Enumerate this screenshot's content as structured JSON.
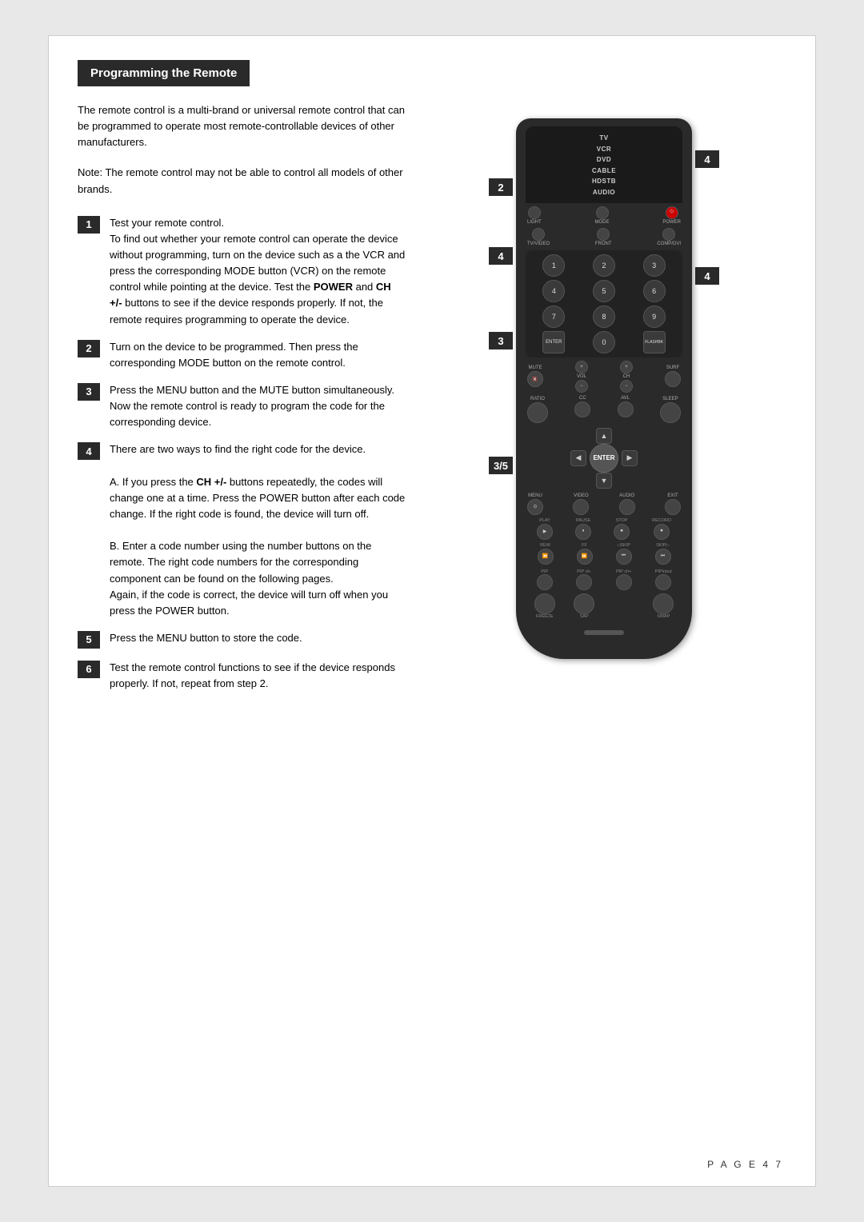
{
  "page": {
    "title": "Programming the Remote",
    "page_number": "P A G E  4 7"
  },
  "intro": {
    "paragraph1": "The remote control is a multi-brand or universal remote control that can be programmed to operate most remote-controllable devices of other manufacturers.",
    "paragraph2": "Note: The remote control may not be able to control all models of other brands."
  },
  "steps": [
    {
      "num": "1",
      "text": "Test your remote control.\nTo find out whether your remote control can operate the device without programming, turn on the device such as a the VCR and press the corresponding MODE button (VCR) on the remote control while pointing at the device. Test the POWER and CH +/- buttons to see if the device responds properly. If not, the remote requires programming to operate the device."
    },
    {
      "num": "2",
      "text": "Turn on the device to be programmed. Then press the corresponding MODE button on the remote control."
    },
    {
      "num": "3",
      "text": "Press the MENU button and the MUTE button simultaneously. Now the remote control is ready to program the code for the corresponding device."
    },
    {
      "num": "4",
      "text": "There are two ways to find the right code for the device.\n\nA. If you press the CH +/- buttons repeatedly, the codes will change one at a time. Press the POWER button after each code change. If the right code is found, the device will turn off.\n\nB. Enter a code number using the number buttons on the remote. The right code numbers for the corresponding component can be found on the following pages.\nAgain, if the code is correct, the device will turn off when you press the POWER button."
    },
    {
      "num": "5",
      "text": "Press the MENU button to store the code."
    },
    {
      "num": "6",
      "text": "Test the remote control functions to see if the device responds properly. If not, repeat from step 2."
    }
  ],
  "remote": {
    "modes": [
      "TV",
      "VCR",
      "DVD",
      "CABLE",
      "HDSTB",
      "AUDIO"
    ],
    "top_buttons": [
      "LIGHT",
      "MODE",
      "POWER"
    ],
    "mid_buttons": [
      "TV/VIDEO",
      "FRONT",
      "COMP/DVI"
    ],
    "numpad": [
      "1",
      "2",
      "3",
      "4",
      "5",
      "6",
      "7",
      "8",
      "9",
      "ENTER",
      "0",
      "FLASHBK"
    ],
    "vol_buttons": [
      "MUTE",
      "VOL+",
      "CH+",
      "SURF",
      "VOL-",
      "CH-"
    ],
    "misc": [
      "CC",
      "AVL",
      "RATIO",
      "SLEEP"
    ],
    "dpad_center": "ENTER",
    "menu_row": [
      "MENU",
      "VIDEO",
      "AUDIO",
      "EXIT"
    ],
    "transport_labels": [
      "PLAY",
      "PAUSE",
      "STOP",
      "RECORD"
    ],
    "transport2_labels": [
      "REW",
      "FF",
      "SKIP-",
      "SKIP+"
    ],
    "pip_labels": [
      "PIP",
      "PIP ch-",
      "PIP ch+",
      "PIPInput"
    ],
    "pip2_labels": [
      "FREEZE",
      "SAP",
      "",
      "SWAP"
    ]
  },
  "side_labels": {
    "left": [
      "2",
      "4",
      "3",
      "3/5"
    ],
    "right": [
      "4",
      "4"
    ]
  }
}
